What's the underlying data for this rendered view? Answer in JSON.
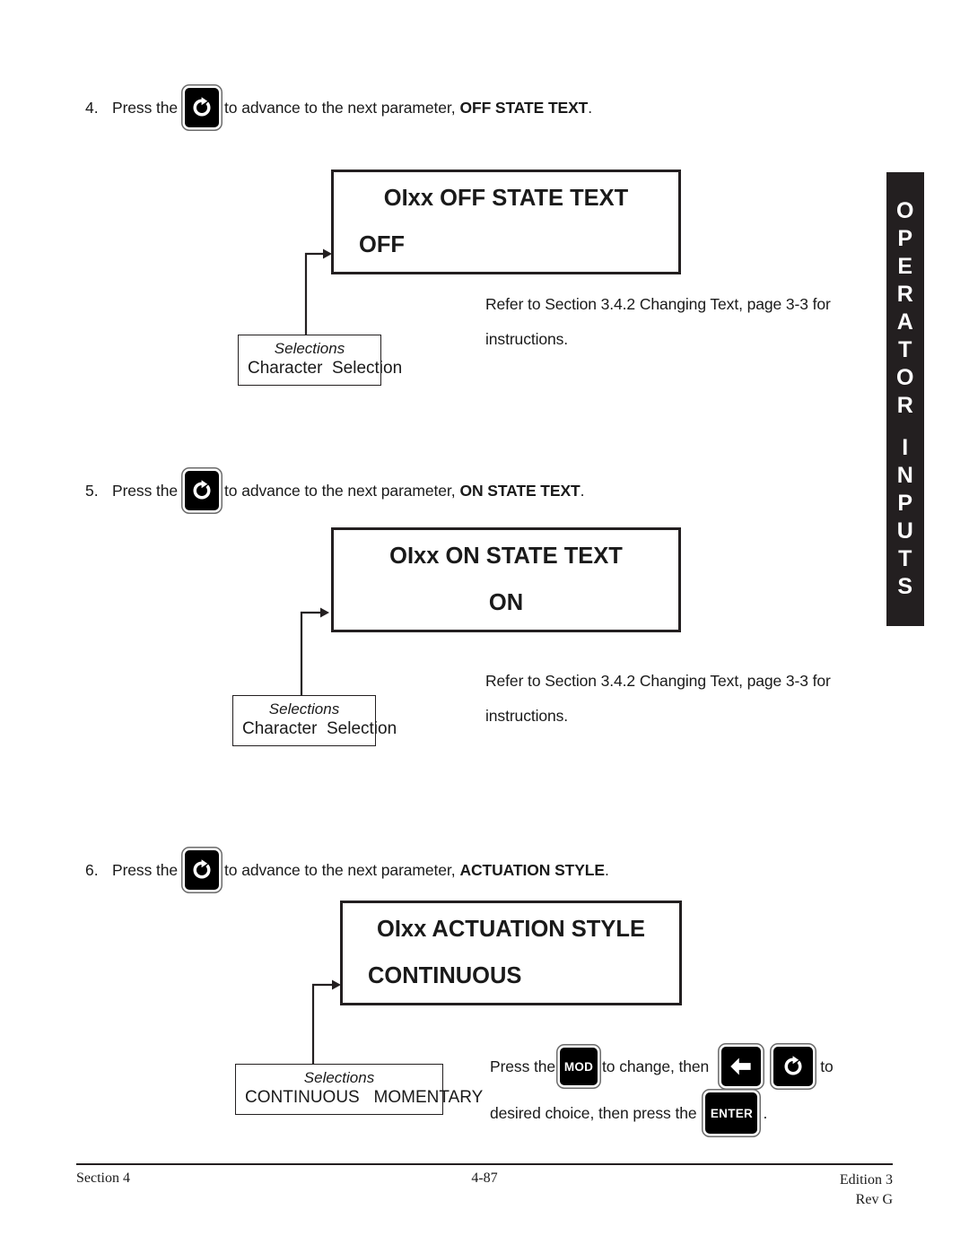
{
  "edge_tab": {
    "label": "OPERATOR INPUTS",
    "line1": "OPERATOR",
    "line2": "INPUTS",
    "background": "#231f20",
    "text_color": "#ffffff"
  },
  "steps": [
    {
      "number": "4.",
      "text_before": "Press the",
      "key_icon": "cycle-arrow-icon",
      "text_after": "to advance to the next parameter,",
      "parameter": "OFF STATE TEXT",
      "period": "."
    },
    {
      "number": "5.",
      "text_before": "Press the",
      "key_icon": "cycle-arrow-icon",
      "text_after": "to advance to the next parameter,",
      "parameter": "ON STATE TEXT",
      "period": "."
    },
    {
      "number": "6.",
      "text_before": "Press the",
      "key_icon": "cycle-arrow-icon",
      "text_after": "to advance to the next parameter,",
      "parameter": "ACTUATION STYLE",
      "period": "."
    }
  ],
  "panels": [
    {
      "title": "OIxx  OFF STATE TEXT",
      "value": "OFF",
      "value_align": "left"
    },
    {
      "title": "OIxx  ON STATE TEXT",
      "value": "ON",
      "value_align": "center"
    },
    {
      "title": "OIxx  ACTUATION  STYLE",
      "value": "CONTINUOUS",
      "value_align": "left"
    }
  ],
  "selections": [
    {
      "heading": "Selections",
      "options": "Character  Selection"
    },
    {
      "heading": "Selections",
      "options": "Character  Selection"
    },
    {
      "heading": "Selections",
      "options": "CONTINUOUS   MOMENTARY"
    }
  ],
  "notes": [
    {
      "line1": "Refer to Section 3.4.2 Changing Text, page 3-3 for",
      "line2": "instructions."
    },
    {
      "line1": "Refer to Section 3.4.2 Changing Text, page 3-3 for",
      "line2": "instructions."
    }
  ],
  "inline_instruction": {
    "t1": "Press the",
    "key_mod": "MOD",
    "t2": "to change, then",
    "key_left": "left-arrow-icon",
    "key_cycle": "cycle-arrow-icon",
    "t3": "to",
    "t4": "desired choice, then press the",
    "key_enter": "ENTER",
    "t5": "."
  },
  "footer": {
    "section": "Section 4",
    "page": "4-87",
    "edition": "Edition 3",
    "revision": "Rev G"
  }
}
